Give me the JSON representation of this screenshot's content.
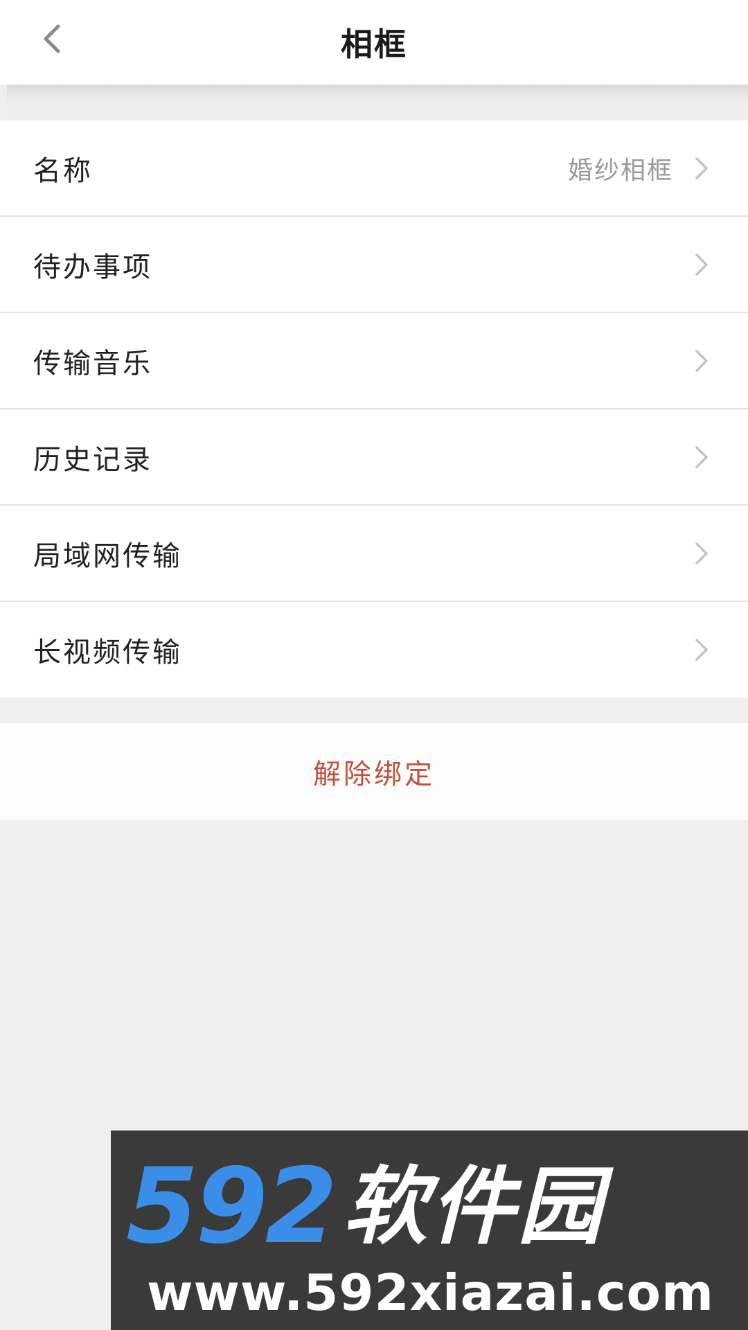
{
  "header": {
    "title": "相框",
    "back_icon": "chevron-left-icon"
  },
  "menu": {
    "items": [
      {
        "label": "名称",
        "value": "婚纱相框"
      },
      {
        "label": "待办事项",
        "value": ""
      },
      {
        "label": "传输音乐",
        "value": ""
      },
      {
        "label": "历史记录",
        "value": ""
      },
      {
        "label": "局域网传输",
        "value": ""
      },
      {
        "label": "长视频传输",
        "value": ""
      }
    ],
    "chevron_icon": "chevron-right-icon"
  },
  "actions": {
    "unbind_label": "解除绑定"
  },
  "watermark": {
    "brand_number": "592",
    "brand_text": "软件园",
    "url": "www.592xiazai.com"
  },
  "colors": {
    "background": "#efefef",
    "danger": "#c0533d",
    "watermark_blue": "#3a8ee8"
  }
}
